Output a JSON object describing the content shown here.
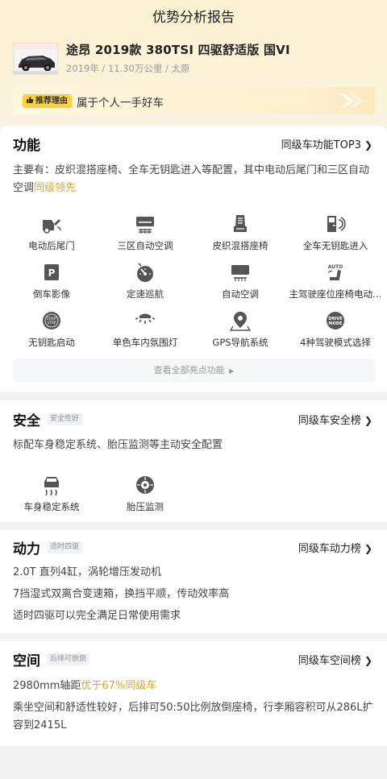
{
  "header": {
    "title": "优势分析报告"
  },
  "car": {
    "title": "途昂 2019款 380TSI 四驱舒适版 国VI",
    "meta": "2019年 / 11.30万公里 / 太原"
  },
  "reason": {
    "badge": "推荐理由",
    "text": "属于个人一手好车"
  },
  "features": {
    "title": "功能",
    "link": "同级车功能TOP3",
    "desc_prefix": "主要有：皮织混搭座椅、全车无钥匙进入等配置，其中电动后尾门和三区自动空调",
    "desc_highlight": "同级领先",
    "items": [
      {
        "label": "电动后尾门",
        "icon": "tailgate-icon"
      },
      {
        "label": "三区自动空调",
        "icon": "climate-control-icon"
      },
      {
        "label": "皮织混搭座椅",
        "icon": "seat-icon"
      },
      {
        "label": "全车无钥匙进入",
        "icon": "keyless-entry-icon"
      },
      {
        "label": "倒车影像",
        "icon": "reverse-camera-icon"
      },
      {
        "label": "定速巡航",
        "icon": "cruise-control-icon"
      },
      {
        "label": "自动空调",
        "icon": "auto-ac-icon"
      },
      {
        "label": "主驾驶座位座椅电动…",
        "icon": "power-seat-icon"
      },
      {
        "label": "无钥匙启动",
        "icon": "push-start-icon"
      },
      {
        "label": "单色车内氛围灯",
        "icon": "ambient-light-icon"
      },
      {
        "label": "GPS导航系统",
        "icon": "gps-icon"
      },
      {
        "label": "4种驾驶模式选择",
        "icon": "drive-mode-icon"
      }
    ],
    "view_all": "查看全部亮点功能",
    "icon_text": {
      "start": "START\nSTOP",
      "auto": "AUTO",
      "drive": "DRIVE\nMODE",
      "p": "P"
    }
  },
  "safety": {
    "title": "安全",
    "tag": "安全性好",
    "link": "同级车安全榜",
    "desc": "标配车身稳定系统、胎压监测等主动安全配置",
    "items": [
      {
        "label": "车身稳定系统",
        "icon": "stability-control-icon"
      },
      {
        "label": "胎压监测",
        "icon": "tire-pressure-icon"
      }
    ]
  },
  "power": {
    "title": "动力",
    "tag": "适时四驱",
    "link": "同级车动力榜",
    "lines": [
      "2.0T 直列4缸，涡轮增压发动机",
      "7挡湿式双离合变速箱，换挡平顺，传动效率高",
      "适时四驱可以完全满足日常使用需求"
    ]
  },
  "space": {
    "title": "空间",
    "tag": "后排可放倒",
    "link": "同级车空间榜",
    "line1_prefix": "2980mm轴距",
    "line1_highlight": "优于67%同级车",
    "line2": "乘坐空间和舒适性较好，后排可50:50比例放倒座椅，行李厢容积可从286L扩容到2415L"
  },
  "colors": {
    "accent": "#e2a224",
    "badge": "#fcd23c",
    "icon": "#555555"
  }
}
